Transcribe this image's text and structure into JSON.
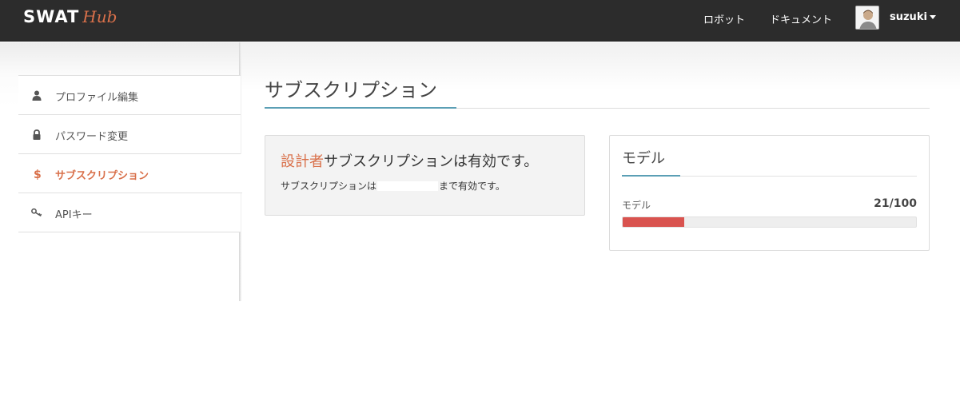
{
  "brand": {
    "name_main": "SWAT",
    "name_accent": "Hub",
    "accent_color": "#d9704a"
  },
  "header": {
    "nav": [
      {
        "label": "ロボット"
      },
      {
        "label": "ドキュメント"
      }
    ],
    "user": {
      "name": "suzuki",
      "avatar_icon": "user-avatar-icon"
    }
  },
  "sidebar": {
    "items": [
      {
        "label": "プロファイル編集",
        "icon": "user-icon",
        "active": false
      },
      {
        "label": "パスワード変更",
        "icon": "lock-icon",
        "active": false
      },
      {
        "label": "サブスクリプション",
        "icon": "dollar-icon",
        "active": true
      },
      {
        "label": "APIキー",
        "icon": "key-icon",
        "active": false
      }
    ]
  },
  "main": {
    "title": "サブスクリプション",
    "status": {
      "plan": "設計者",
      "heading_suffix": "サブスクリプションは有効です。",
      "line_prefix": "サブスクリプションは",
      "line_suffix": "まで有効です。"
    },
    "model": {
      "title": "モデル",
      "label": "モデル",
      "count": "21/100",
      "used": 21,
      "limit": 100,
      "bar_color": "#d9534f"
    }
  }
}
